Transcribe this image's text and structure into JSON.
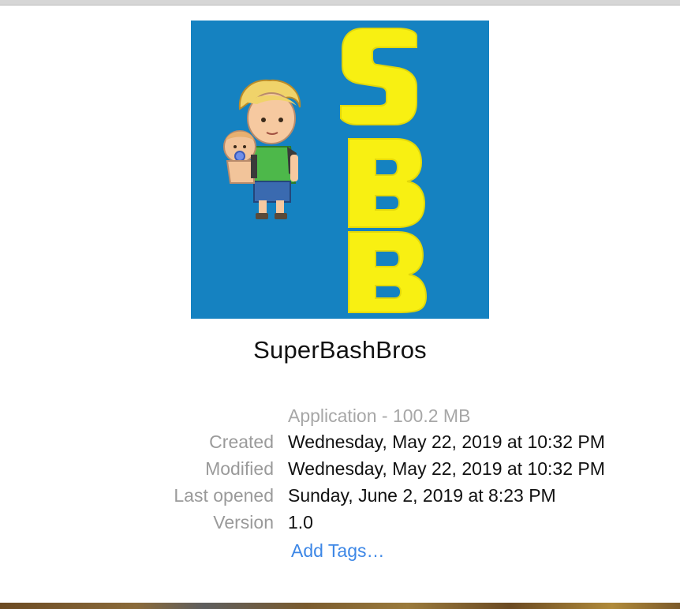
{
  "app": {
    "name": "SuperBashBros",
    "icon_name": "superbashbros-app-icon",
    "icon_letters": [
      "S",
      "B",
      "B"
    ],
    "icon_bg_color": "#1582c1",
    "icon_letter_color": "#f8f012"
  },
  "info": {
    "kind": "Application - 100.2 MB",
    "rows": [
      {
        "label": "Created",
        "value": "Wednesday, May 22, 2019 at 10:32 PM"
      },
      {
        "label": "Modified",
        "value": "Wednesday, May 22, 2019 at 10:32 PM"
      },
      {
        "label": "Last opened",
        "value": "Sunday, June 2, 2019 at 8:23 PM"
      },
      {
        "label": "Version",
        "value": "1.0"
      }
    ]
  },
  "tags": {
    "add_label": "Add Tags…"
  }
}
